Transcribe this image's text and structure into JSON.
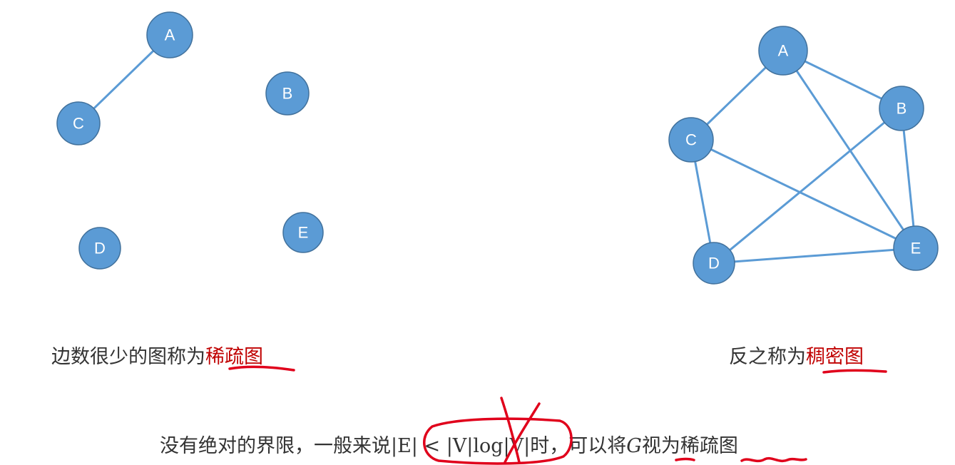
{
  "sparse_graph": {
    "nodes": [
      "A",
      "B",
      "C",
      "D",
      "E"
    ],
    "edges": [
      [
        "A",
        "C"
      ]
    ]
  },
  "dense_graph": {
    "nodes": [
      "A",
      "B",
      "C",
      "D",
      "E"
    ],
    "edges": [
      [
        "A",
        "B"
      ],
      [
        "A",
        "C"
      ],
      [
        "A",
        "E"
      ],
      [
        "B",
        "D"
      ],
      [
        "B",
        "E"
      ],
      [
        "C",
        "D"
      ],
      [
        "C",
        "E"
      ],
      [
        "D",
        "E"
      ]
    ]
  },
  "captions": {
    "sparse_prefix": "边数很少的图称为",
    "sparse_term": "稀疏图",
    "dense_prefix": "反之称为",
    "dense_term": "稠密图",
    "rule_prefix": "没有绝对的界限，一般来说",
    "rule_formula": "|E| < |V|log|V|",
    "rule_mid": "时，可以将",
    "rule_var": "G",
    "rule_mid2": "视为",
    "rule_term": "稀疏图"
  },
  "colors": {
    "node_fill": "#5b9bd5",
    "edge": "#5b9bd5",
    "highlight": "#c00000",
    "annotation_ink": "#e0001b"
  }
}
